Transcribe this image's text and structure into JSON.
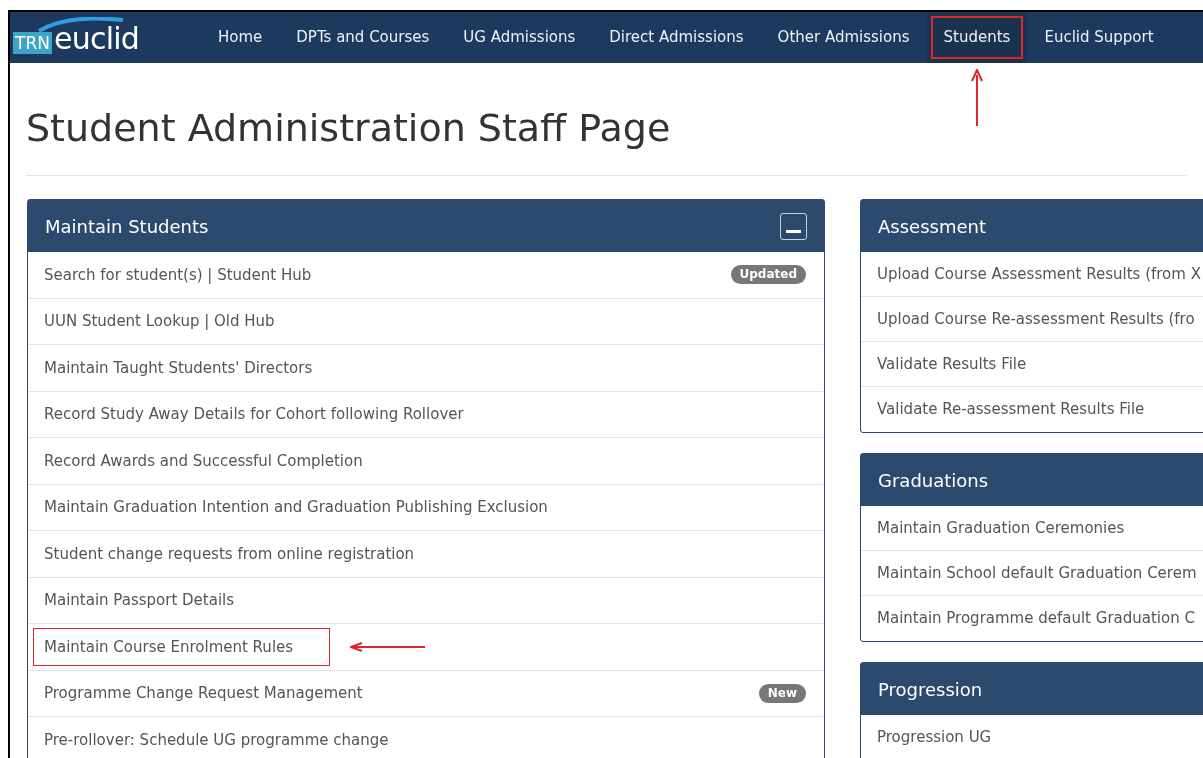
{
  "logo": {
    "badge": "TRN",
    "name": "euclid"
  },
  "nav": [
    {
      "label": "Home",
      "selected": false,
      "highlighted": false
    },
    {
      "label": "DPTs and Courses",
      "selected": false,
      "highlighted": false
    },
    {
      "label": "UG Admissions",
      "selected": false,
      "highlighted": false
    },
    {
      "label": "Direct Admissions",
      "selected": false,
      "highlighted": false
    },
    {
      "label": "Other Admissions",
      "selected": false,
      "highlighted": false
    },
    {
      "label": "Students",
      "selected": true,
      "highlighted": true
    },
    {
      "label": "Euclid Support",
      "selected": false,
      "highlighted": false
    }
  ],
  "page_title": "Student Administration Staff Page",
  "left_panels": [
    {
      "title": "Maintain Students",
      "collapsible": true,
      "items": [
        {
          "label": "Search for student(s) | Student Hub",
          "badge": "Updated",
          "highlighted": false
        },
        {
          "label": "UUN Student Lookup | Old Hub",
          "highlighted": false
        },
        {
          "label": "Maintain Taught Students' Directors",
          "highlighted": false
        },
        {
          "label": "Record Study Away Details for Cohort following Rollover",
          "highlighted": false
        },
        {
          "label": "Record Awards and Successful Completion",
          "highlighted": false
        },
        {
          "label": "Maintain Graduation Intention and Graduation Publishing Exclusion",
          "highlighted": false
        },
        {
          "label": "Student change requests from online registration",
          "highlighted": false
        },
        {
          "label": "Maintain Passport Details",
          "highlighted": false
        },
        {
          "label": "Maintain Course Enrolment Rules",
          "highlighted": true
        },
        {
          "label": "Programme Change Request Management",
          "badge": "New",
          "highlighted": false
        },
        {
          "label": "Pre-rollover: Schedule UG programme change",
          "highlighted": false
        }
      ]
    }
  ],
  "right_panels": [
    {
      "title": "Assessment",
      "items": [
        {
          "label": "Upload Course Assessment Results (from X",
          "highlighted": false
        },
        {
          "label": "Upload Course Re-assessment Results (fro",
          "highlighted": false
        },
        {
          "label": "Validate Results File",
          "highlighted": false
        },
        {
          "label": "Validate Re-assessment Results File",
          "highlighted": false
        }
      ]
    },
    {
      "title": "Graduations",
      "items": [
        {
          "label": "Maintain Graduation Ceremonies",
          "highlighted": false
        },
        {
          "label": "Maintain School default Graduation Cerem",
          "highlighted": false
        },
        {
          "label": "Maintain Programme default Graduation C",
          "highlighted": false
        }
      ]
    },
    {
      "title": "Progression",
      "items": [
        {
          "label": "Progression UG",
          "highlighted": false
        }
      ]
    }
  ]
}
